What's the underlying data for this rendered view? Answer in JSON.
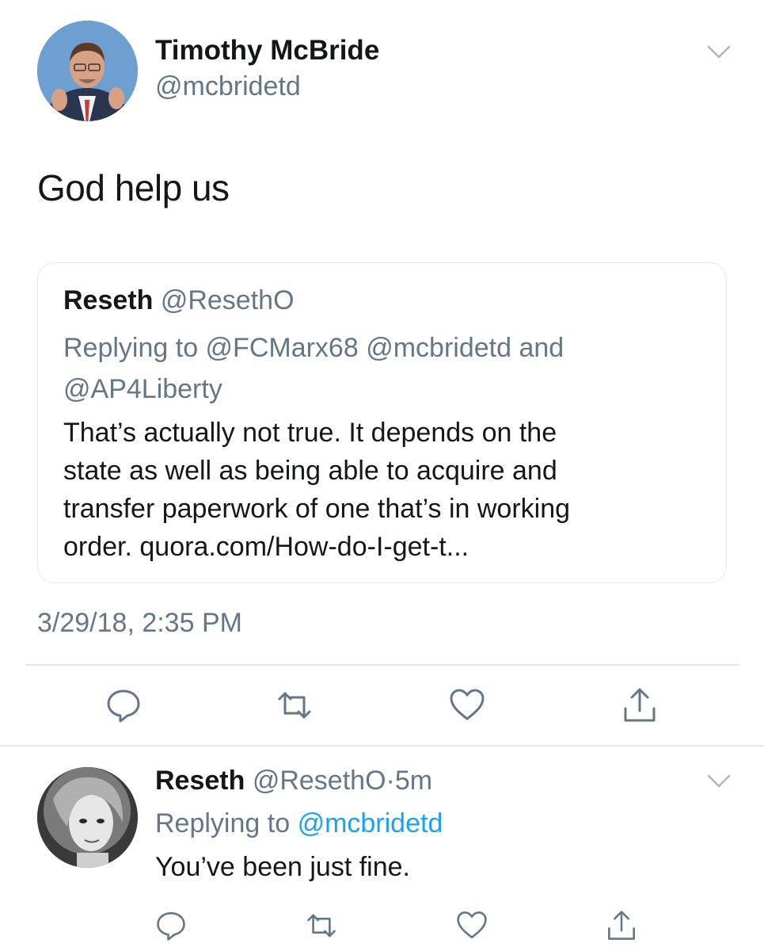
{
  "tweet": {
    "author_name": "Timothy McBride",
    "author_handle": "@mcbridetd",
    "text": "God help us",
    "timestamp": "3/29/18, 2:35 PM",
    "avatar_icon": "person-photo-avatar",
    "menu_icon": "chevron-down-icon"
  },
  "quote": {
    "name": "Reseth",
    "handle": "@ResethO",
    "replying_line1": "Replying to @FCMarx68 @mcbridetd and",
    "replying_line2": "@AP4Liberty",
    "text_line1": "That’s actually not true. It depends on the",
    "text_line2": "state as well as being able to acquire and",
    "text_line3": "transfer paperwork of one that’s in working",
    "text_line4": "order. quora.com/How-do-I-get-t..."
  },
  "actions": [
    {
      "name": "reply",
      "icon": "reply-icon"
    },
    {
      "name": "retweet",
      "icon": "retweet-icon"
    },
    {
      "name": "like",
      "icon": "heart-icon"
    },
    {
      "name": "share",
      "icon": "share-icon"
    }
  ],
  "reply": {
    "name": "Reseth",
    "handle": "@ResethO",
    "separator": "·",
    "time": "5m",
    "replying_prefix": "Replying to",
    "replying_mention": "@mcbridetd",
    "text": "You’ve been just fine."
  },
  "colors": {
    "text_primary": "#14171a",
    "text_secondary": "#657786",
    "link": "#1da1f2",
    "border": "#e1e8ed"
  }
}
